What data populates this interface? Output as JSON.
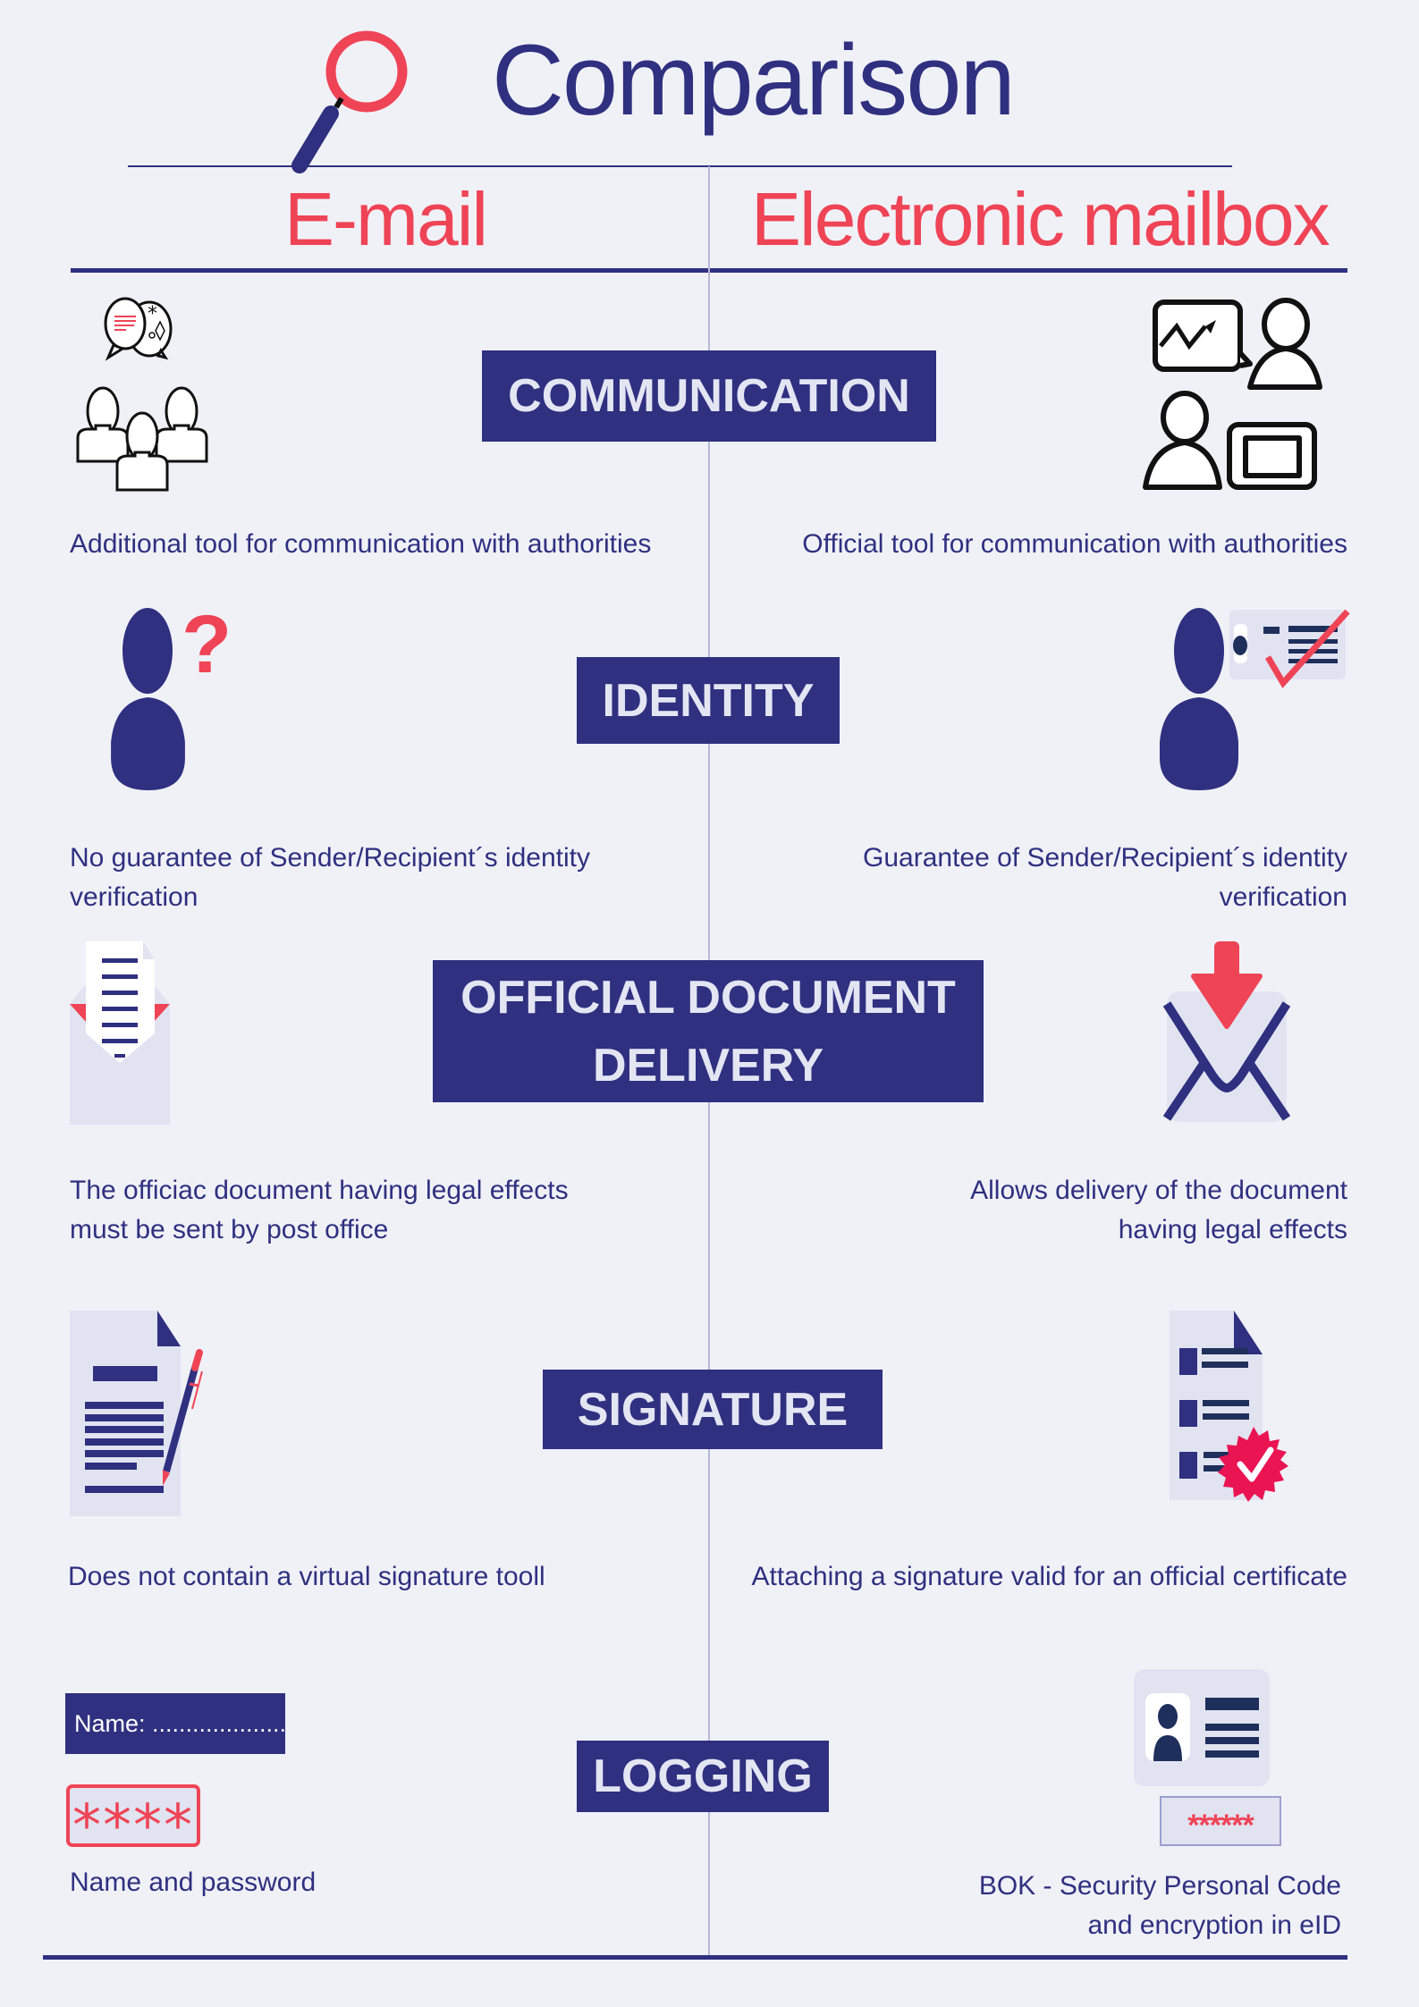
{
  "header": {
    "title": "Comparison",
    "left_heading": "E-mail",
    "right_heading": "Electronic mailbox"
  },
  "colors": {
    "navy": "#2f3080",
    "red": "#ef4456",
    "background": "#f0f1f7",
    "light": "#e1e3f1"
  },
  "rows": [
    {
      "label": "COMMUNICATION",
      "left_icon": "people-chat-icon",
      "right_icon": "presentation-meeting-icon",
      "left_text": "Additional tool for communication with authorities",
      "right_text": "Official tool for communication with authorities"
    },
    {
      "label": "IDENTITY",
      "left_icon": "unknown-person-icon",
      "right_icon": "verified-id-person-icon",
      "left_text_lines": [
        "No guarantee of Sender/Recipient´s identity",
        "verification"
      ],
      "right_text_lines": [
        "Guarantee of Sender/Recipient´s identity",
        "verification"
      ]
    },
    {
      "label_lines": [
        "OFFICIAL DOCUMENT",
        "DELIVERY"
      ],
      "left_icon": "open-envelope-document-icon",
      "right_icon": "envelope-download-icon",
      "left_text_lines": [
        "The officiac document having legal effects",
        "must be sent by post office"
      ],
      "right_text_lines": [
        "Allows delivery of the document",
        "having legal effects"
      ]
    },
    {
      "label": "SIGNATURE",
      "left_icon": "document-pen-icon",
      "right_icon": "certified-document-icon",
      "left_text": "Does not contain a virtual signature tooll",
      "right_text": "Attaching a signature valid for an official certificate"
    },
    {
      "label": "LOGGING",
      "left_icon": "name-password-icon",
      "right_icon": "eid-card-icon",
      "left_name_field": "Name: ....................",
      "left_password": "****",
      "right_password": "******",
      "left_text": "Name and password",
      "right_text_lines": [
        "BOK - Security Personal Code",
        "and encryption in eID"
      ]
    }
  ]
}
